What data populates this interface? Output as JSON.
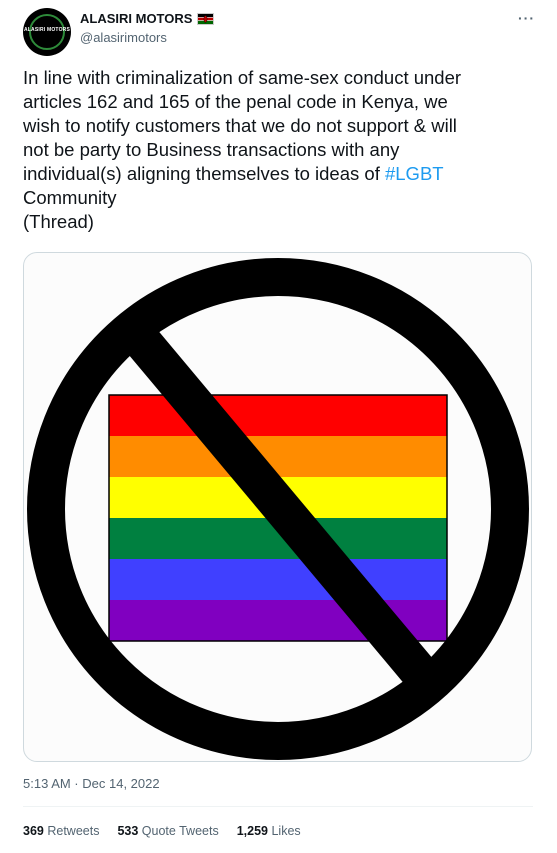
{
  "author": {
    "display_name": "ALASIRI MOTORS",
    "handle": "@alasirimotors",
    "avatar_text": "ALASIRI MOTORS",
    "flag_icon": "kenya-flag"
  },
  "menu": {
    "more_label": "···"
  },
  "tweet": {
    "text_lines": [
      "In line with criminalization of same-sex conduct under",
      "articles 162 and 165 of the penal code in Kenya, we",
      "wish to notify customers that we do not support & will",
      "not be party to Business transactions with any",
      "individual(s) aligning themselves to ideas of "
    ],
    "hashtag": "#LGBT",
    "line_6": "Community",
    "line_7": "(Thread)"
  },
  "media": {
    "stripe_colors": [
      "#ff0000",
      "#ff8c00",
      "#ffff00",
      "#008040",
      "#4040ff",
      "#8000c0"
    ],
    "prohibition_color": "#000000"
  },
  "timestamp": "5:13 AM · Dec 14, 2022",
  "stats": {
    "retweets_count": "369",
    "retweets_label": "Retweets",
    "quote_count": "533",
    "quote_label": "Quote Tweets",
    "likes_count": "1,259",
    "likes_label": "Likes"
  }
}
